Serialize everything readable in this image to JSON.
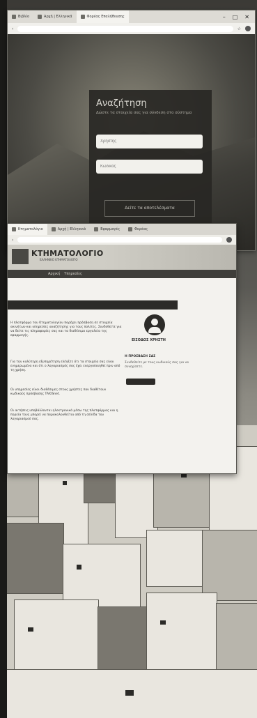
{
  "browser_top": {
    "tabs": [
      {
        "label": "Βιβλίο"
      },
      {
        "label": "Αρχή | Ελληνικά"
      },
      {
        "label": "Φορέας Επαλήθευσης"
      }
    ],
    "window_controls": [
      "–",
      "□",
      "✕"
    ],
    "login": {
      "title": "Αναζήτηση",
      "subtitle": "Δώστε τα στοιχεία σας για σύνδεση στο σύστημα",
      "username_placeholder": "Χρήστης",
      "password_placeholder": "Κωδικός",
      "button_label": "Δείτε τα αποτελέσματα"
    }
  },
  "browser_bottom": {
    "tabs": [
      {
        "label": "Κτηματολόγιο"
      },
      {
        "label": "Αρχή | Ελληνικά"
      },
      {
        "label": "Εφαρμογές"
      },
      {
        "label": "Φορέας"
      }
    ],
    "site": {
      "title": "ΚΤΗΜΑΤΟΛΟΓΙΟ",
      "subtitle": "ΕΛΛΗΝΙΚΟ ΚΤΗΜΑΤΟΛΟΓΙΟ",
      "nav": [
        "Αρχική",
        "Υπηρεσίες"
      ]
    },
    "content": {
      "para1": "Η πλατφόρμα του Κτηματολογίου παρέχει πρόσβαση σε στοιχεία ακινήτων και υπηρεσίες αναζήτησης για τους πολίτες. Συνδεθείτε για να δείτε τις πληροφορίες σας και τα διαθέσιμα εργαλεία της εφαρμογής.",
      "para2": "Για την καλύτερη εξυπηρέτηση ελέγξτε ότι τα στοιχεία σας είναι ενημερωμένα και ότι ο λογαριασμός σας έχει ενεργοποιηθεί πριν από τη χρήση.",
      "para3": "Οι υπηρεσίες είναι διαθέσιμες στους χρήστες που διαθέτουν κωδικούς πρόσβασης TAXISnet.",
      "para4": "Οι αιτήσεις υποβάλλονται ηλεκτρονικά μέσω της πλατφόρμας και η πορεία τους μπορεί να παρακολουθείται από τη σελίδα του λογαριασμού σας."
    },
    "side": {
      "user_label": "ΕΙΣΟΔΟΣ ΧΡΗΣΤΗ",
      "heading": "Η ΠΡΟΣΒΑΣΗ ΣΑΣ",
      "text": "Συνδεθείτε με τους κωδικούς σας για να συνεχίσετε."
    }
  }
}
